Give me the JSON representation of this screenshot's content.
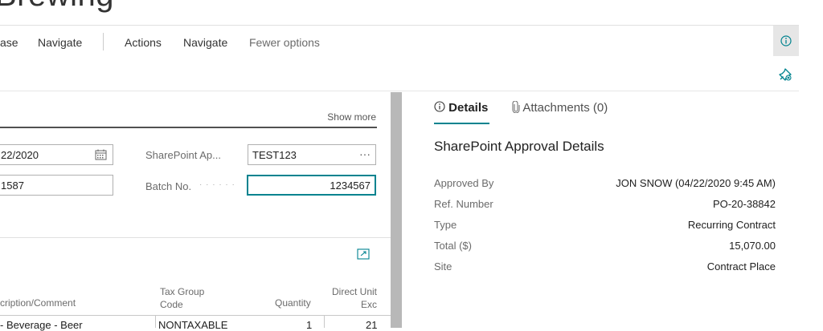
{
  "page": {
    "title_partial": "Brewing"
  },
  "actions": {
    "release_partial": "ase",
    "navigate1": "Navigate",
    "actions": "Actions",
    "navigate2": "Navigate",
    "fewer_options": "Fewer options"
  },
  "general": {
    "show_more": "Show more",
    "date_value_partial": "22/2020",
    "number_value_partial": "1587",
    "sharepoint_label": "SharePoint Ap...",
    "sharepoint_value": "TEST123",
    "sharepoint_lookup": "···",
    "batch_label": "Batch No.",
    "batch_dots": "· · · · · ·",
    "batch_value": "1234567"
  },
  "lines": {
    "columns": {
      "description_partial": "cription/Comment",
      "tax_group_line1": "Tax Group",
      "tax_group_line2": "Code",
      "quantity": "Quantity",
      "direct_unit_line1": "Direct Unit",
      "direct_unit_line2": "Exc"
    },
    "row1": {
      "description_partial": "- Beverage - Beer",
      "tax_group": "NONTAXABLE",
      "quantity": "1",
      "direct_unit_partial": "21"
    }
  },
  "factbox": {
    "tabs": {
      "details": "Details",
      "attachments": "Attachments (0)"
    },
    "panel_title": "SharePoint Approval Details",
    "rows": [
      {
        "label": "Approved By",
        "value": "JON SNOW (04/22/2020 9:45 AM)"
      },
      {
        "label": "Ref. Number",
        "value": "PO-20-38842"
      },
      {
        "label": "Type",
        "value": "Recurring Contract"
      },
      {
        "label": "Total ($)",
        "value": "15,070.00"
      },
      {
        "label": "Site",
        "value": "Contract Place"
      }
    ]
  },
  "colors": {
    "accent": "#00838f",
    "input_focus_border": "#00838f"
  },
  "icons": [
    "calendar-icon",
    "info-icon",
    "pin-icon",
    "expand-icon",
    "paperclip-icon"
  ]
}
